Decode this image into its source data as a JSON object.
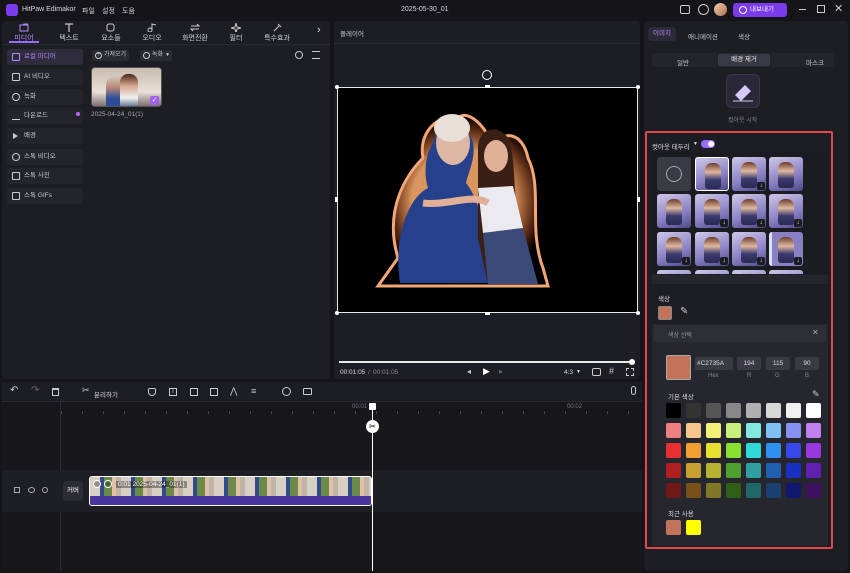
{
  "titlebar": {
    "app_name": "HitPaw Edimakor",
    "menu": [
      "파일",
      "설정",
      "도움"
    ],
    "project_title": "2025-05-30_01",
    "export_label": "내보내기",
    "accent": "#7c3aed"
  },
  "toolbar": {
    "tools": [
      {
        "label": "미디어",
        "icon": "media-folder-icon",
        "active": true
      },
      {
        "label": "텍스트",
        "icon": "text-icon"
      },
      {
        "label": "요소들",
        "icon": "elements-icon"
      },
      {
        "label": "오디오",
        "icon": "audio-icon"
      },
      {
        "label": "화면전환",
        "icon": "transition-icon"
      },
      {
        "label": "필터",
        "icon": "filter-icon"
      },
      {
        "label": "특수효과",
        "icon": "effects-icon"
      }
    ]
  },
  "sidebar": {
    "items": [
      {
        "label": "로컬 미디어",
        "icon": "folder-icon",
        "active": true
      },
      {
        "label": "AI 비디오",
        "icon": "ai-icon"
      },
      {
        "label": "녹화",
        "icon": "record-icon"
      },
      {
        "label": "다운로드",
        "icon": "download-icon",
        "dot": true
      },
      {
        "label": "배경",
        "icon": "background-icon"
      },
      {
        "label": "스톡 비디오",
        "icon": "stock-video-icon"
      },
      {
        "label": "스톡 사진",
        "icon": "stock-photo-icon"
      },
      {
        "label": "스톡 GIFs",
        "icon": "gif-icon"
      }
    ]
  },
  "media": {
    "import_label": "가져오기",
    "record_label": "녹화",
    "item_name": "2025-04-24_01(1)"
  },
  "player": {
    "title": "플레이어",
    "current_time": "00:01:05",
    "total_time": "00:01:05",
    "ratio": "4:3",
    "progress": 1.0
  },
  "props": {
    "tabs": [
      "이미지",
      "애니메이션",
      "색상"
    ],
    "subtabs": [
      "일반",
      "배경 제거",
      "마스크"
    ],
    "cutout_start": "컷아웃 시작",
    "outline_label": "컷아웃 테두리",
    "outline_enabled": true,
    "color_section": "색상",
    "selected_color": "#C2735A",
    "picker_title": "색상 선택",
    "hex_value": "#C2735A",
    "hex_label": "Hex",
    "r_value": "194",
    "g_value": "115",
    "b_value": "90",
    "r_label": "R",
    "g_label": "G",
    "b_label": "B",
    "basic_colors_label": "기본 색상",
    "recent_label": "최근 사용",
    "basic_colors": [
      "#000000",
      "#333333",
      "#555555",
      "#888888",
      "#b0b0b0",
      "#d8d8d8",
      "#f0f0f0",
      "#ffffff",
      "#f08080",
      "#f5c78a",
      "#f5f07a",
      "#c8f07a",
      "#80e8e0",
      "#80c0f5",
      "#8890f0",
      "#c080f0",
      "#e83030",
      "#f0a030",
      "#e8e030",
      "#88e030",
      "#30d8d8",
      "#3090f0",
      "#3848e8",
      "#9838e0",
      "#b02020",
      "#c8a030",
      "#b8b030",
      "#50a030",
      "#30a0a0",
      "#2060b0",
      "#1830c0",
      "#6020b0",
      "#701818",
      "#785018",
      "#807828",
      "#306018",
      "#206868",
      "#184070",
      "#101870",
      "#401060"
    ],
    "recent_colors": [
      "#C2735A",
      "#ffff00"
    ],
    "highlight_color": "#e0484e"
  },
  "timeline": {
    "split_label": "분리하기",
    "marks": [
      "00:01",
      "00:02"
    ],
    "cover_label": "커버",
    "clip_label": "0:01 2025-04-24_01(1)"
  }
}
